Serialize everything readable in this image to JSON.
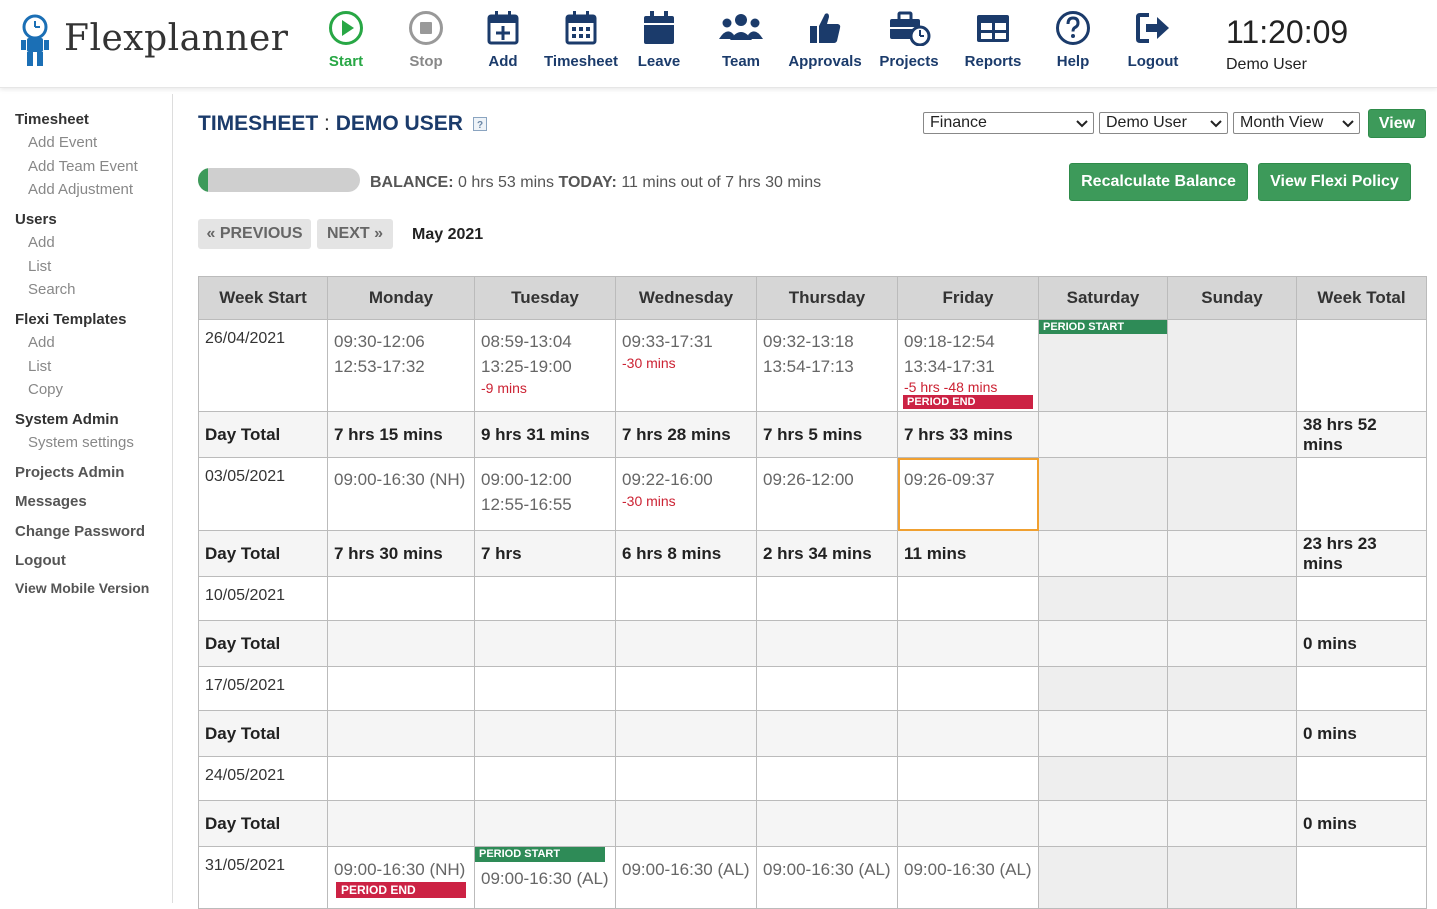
{
  "app": {
    "name": "Flexplanner",
    "clock": "11:20:09",
    "current_user": "Demo User"
  },
  "nav": [
    {
      "id": "start",
      "label": "Start",
      "icon": "play-icon"
    },
    {
      "id": "stop",
      "label": "Stop",
      "icon": "stop-icon"
    },
    {
      "id": "add",
      "label": "Add",
      "icon": "calendar-plus-icon"
    },
    {
      "id": "timesheet",
      "label": "Timesheet",
      "icon": "calendar-grid-icon"
    },
    {
      "id": "leave",
      "label": "Leave",
      "icon": "calendar-icon"
    },
    {
      "id": "team",
      "label": "Team",
      "icon": "team-icon"
    },
    {
      "id": "approvals",
      "label": "Approvals",
      "icon": "thumbs-up-icon"
    },
    {
      "id": "projects",
      "label": "Projects",
      "icon": "briefcase-clock-icon"
    },
    {
      "id": "reports",
      "label": "Reports",
      "icon": "table-icon"
    },
    {
      "id": "help",
      "label": "Help",
      "icon": "question-icon"
    },
    {
      "id": "logout",
      "label": "Logout",
      "icon": "sign-out-icon"
    }
  ],
  "sidebar": {
    "timesheet": "Timesheet",
    "add_event": "Add Event",
    "add_team_event": "Add Team Event",
    "add_adjustment": "Add Adjustment",
    "users": "Users",
    "users_add": "Add",
    "users_list": "List",
    "users_search": "Search",
    "flexi_templates": "Flexi Templates",
    "ft_add": "Add",
    "ft_list": "List",
    "ft_copy": "Copy",
    "system_admin": "System Admin",
    "system_settings": "System settings",
    "projects_admin": "Projects Admin",
    "messages": "Messages",
    "change_password": "Change Password",
    "logout": "Logout",
    "mobile": "View Mobile Version"
  },
  "header": {
    "title_left": "TIMESHEET",
    "title_sep": " : ",
    "title_right": "DEMO USER"
  },
  "filters": {
    "department": "Finance",
    "user": "Demo User",
    "view_mode": "Month View",
    "view_button": "View"
  },
  "buttons": {
    "recalculate": "Recalculate Balance",
    "flexi_policy": "View Flexi Policy",
    "previous": "« PREVIOUS",
    "next": "NEXT »"
  },
  "balance": {
    "label": "BALANCE:",
    "value": " 0 hrs 53 mins ",
    "today_label": "TODAY:",
    "today_value": " 11 mins out of 7 hrs 30 mins",
    "progress_fraction": 0.024
  },
  "month": "May 2021",
  "table": {
    "headers": [
      "Week Start",
      "Monday",
      "Tuesday",
      "Wednesday",
      "Thursday",
      "Friday",
      "Saturday",
      "Sunday",
      "Week Total"
    ],
    "total_label": "Day Total",
    "period_start": "PERIOD START",
    "period_end": "PERIOD END",
    "weeks": [
      {
        "start": "26/04/2021",
        "mon": [
          "09:30-12:06",
          "12:53-17:32"
        ],
        "tue": [
          "08:59-13:04",
          "13:25-19:00"
        ],
        "tue_adj": "-9 mins",
        "wed": [
          "09:33-17:31"
        ],
        "wed_adj": "-30 mins",
        "thu": [
          "09:32-13:18",
          "13:54-17:13"
        ],
        "fri": [
          "09:18-12:54",
          "13:34-17:31"
        ],
        "fri_adj": "-5 hrs -48 mins",
        "totals": [
          "7 hrs 15 mins",
          "9 hrs 31 mins",
          "7 hrs 28 mins",
          "7 hrs 5 mins",
          "7 hrs 33 mins",
          "",
          "",
          "38 hrs 52 mins"
        ]
      },
      {
        "start": "03/05/2021",
        "mon": [
          "09:00-16:30 (NH)"
        ],
        "tue": [
          "09:00-12:00",
          "12:55-16:55"
        ],
        "wed": [
          "09:22-16:00"
        ],
        "wed_adj": "-30 mins",
        "thu": [
          "09:26-12:00"
        ],
        "fri": [
          "09:26-09:37"
        ],
        "totals": [
          "7 hrs 30 mins",
          "7 hrs",
          "6 hrs 8 mins",
          "2 hrs 34 mins",
          "11 mins",
          "",
          "",
          "23 hrs 23 mins"
        ]
      },
      {
        "start": "10/05/2021",
        "week_total": "0 mins"
      },
      {
        "start": "17/05/2021",
        "week_total": "0 mins"
      },
      {
        "start": "24/05/2021",
        "week_total": "0 mins"
      },
      {
        "start": "31/05/2021",
        "mon": "09:00-16:30 (NH)",
        "tue": "09:00-16:30 (AL)",
        "wed": "09:00-16:30 (AL)",
        "thu": "09:00-16:30 (AL)",
        "fri": "09:00-16:30 (AL)"
      }
    ]
  },
  "colors": {
    "navy": "#1b3b6b",
    "green": "#3d9a5a",
    "red": "#cc2244",
    "today_outline": "#f0a030"
  }
}
